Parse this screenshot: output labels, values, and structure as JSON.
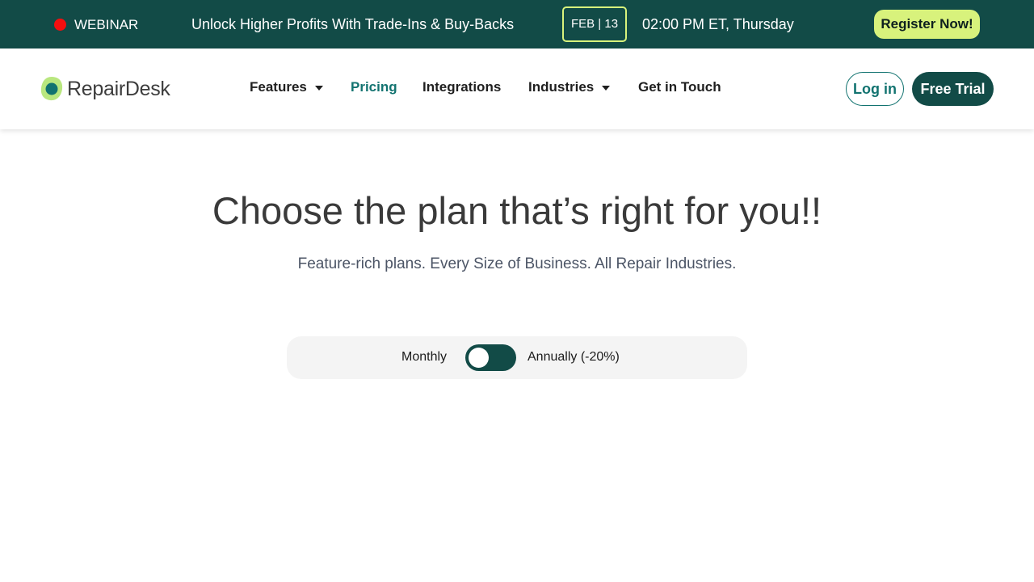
{
  "banner": {
    "badge": "WEBINAR",
    "headline": "Unlock Higher Profits With Trade-Ins & Buy-Backs",
    "date": "FEB | 13",
    "time": "02:00 PM ET, Thursday",
    "register_label": "Register Now!"
  },
  "brand": {
    "name": "RepairDesk"
  },
  "nav": {
    "items": [
      {
        "label": "Features",
        "has_dropdown": true
      },
      {
        "label": "Pricing",
        "active": true
      },
      {
        "label": "Integrations"
      },
      {
        "label": "Industries",
        "has_dropdown": true
      },
      {
        "label": "Get in Touch"
      }
    ],
    "login_label": "Log in",
    "trial_label": "Free Trial"
  },
  "hero": {
    "title": "Choose the plan that’s right for you!!",
    "subtitle": "Feature-rich plans. Every Size of Business. All Repair Industries."
  },
  "billing": {
    "monthly_label": "Monthly",
    "annual_label": "Annually (-20%)",
    "selected": "Monthly"
  },
  "colors": {
    "brand_dark": "#124b47",
    "accent_lime": "#d8f27c",
    "link_teal": "#127370",
    "live_red": "#f50f0f"
  },
  "icons": [
    "live-dot-icon",
    "repairdesk-logo-icon",
    "caret-down-icon"
  ]
}
